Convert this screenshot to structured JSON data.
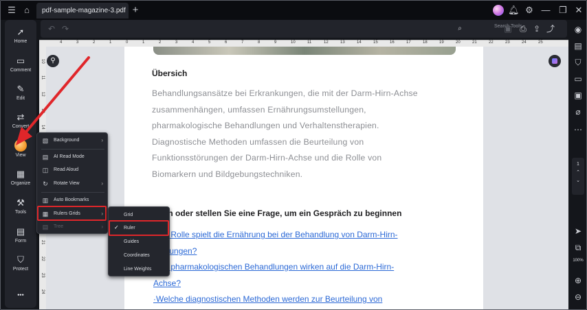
{
  "titlebar": {
    "tab_title": "pdf-sample-magazine-3.pdf",
    "tab_close": "✕",
    "add_tab": "+"
  },
  "left_toolbar": {
    "items": [
      {
        "label": "Home"
      },
      {
        "label": "Comment"
      },
      {
        "label": "Edit"
      },
      {
        "label": "Convert"
      },
      {
        "label": "View"
      },
      {
        "label": "Organize"
      },
      {
        "label": "Tools"
      },
      {
        "label": "Form"
      },
      {
        "label": "Protect"
      }
    ],
    "more": "•••"
  },
  "subbar": {
    "search_placeholder": "Search Tools"
  },
  "ruler": {
    "h_ticks": [
      "4",
      "3",
      "2",
      "1",
      "0",
      "1",
      "2",
      "3",
      "4",
      "5",
      "6",
      "7",
      "8",
      "9",
      "10",
      "11",
      "12",
      "13",
      "14",
      "15",
      "16",
      "17",
      "18",
      "19",
      "20",
      "21",
      "22",
      "23",
      "24",
      "25"
    ],
    "v_ticks": [
      "10",
      "11",
      "12",
      "13",
      "14",
      "15",
      "16",
      "17",
      "18",
      "19",
      "20",
      "21",
      "22",
      "23",
      "24"
    ]
  },
  "document": {
    "heading": "Übersich",
    "paragraph_lines": [
      "Behandlungsansätze bei Erkrankungen, die mit der Darm-Hirn-Achse",
      "zusammenhängen, umfassen Ernährungsumstellungen,",
      "pharmakologische Behandlungen und Verhaltenstherapien.",
      "Diagnostische Methoden umfassen die Beurteilung von",
      "Funktionsstörungen der Darm-Hirn-Achse und die Rolle von",
      "Biomarkern und Bildgebungstechniken."
    ],
    "question_heading": "llen oder stellen Sie eine Frage, um ein Gespräch zu beginnen",
    "link_lines": [
      "lche Rolle spielt die Ernährung bei der Behandlung von Darm-Hirn-",
      "rankungen?",
      "lche pharmakologischen Behandlungen wirken auf die Darm-Hirn-",
      "Achse?",
      "·Welche diagnostischen Methoden werden zur Beurteilung von"
    ]
  },
  "view_menu": {
    "items": [
      {
        "label": "Background",
        "icon": "background-icon",
        "submenu": true
      },
      {
        "label": "AI Read Mode",
        "icon": "read-mode-icon",
        "submenu": false
      },
      {
        "label": "Read Aloud",
        "icon": "speaker-icon",
        "submenu": false
      },
      {
        "label": "Rotate View",
        "icon": "rotate-icon",
        "submenu": true
      },
      {
        "label": "Auto Bookmarks",
        "icon": "bookmark-icon",
        "submenu": false
      },
      {
        "label": "Rulers  Grids",
        "icon": "ruler-icon",
        "submenu": true
      },
      {
        "label": "Tree",
        "icon": "tree-icon",
        "submenu": true,
        "disabled": true
      }
    ]
  },
  "rulers_submenu": {
    "items": [
      {
        "label": "Grid",
        "checked": false
      },
      {
        "label": "Ruler",
        "checked": true
      },
      {
        "label": "Guides",
        "checked": false
      },
      {
        "label": "Coordinates",
        "checked": false
      },
      {
        "label": "Line Weights",
        "checked": false
      }
    ]
  },
  "rightbar": {
    "page_number": "1",
    "zoom_level": "100%"
  },
  "colors": {
    "highlight": "#e0262a",
    "link": "#2a68d6",
    "background": "#14161b"
  }
}
